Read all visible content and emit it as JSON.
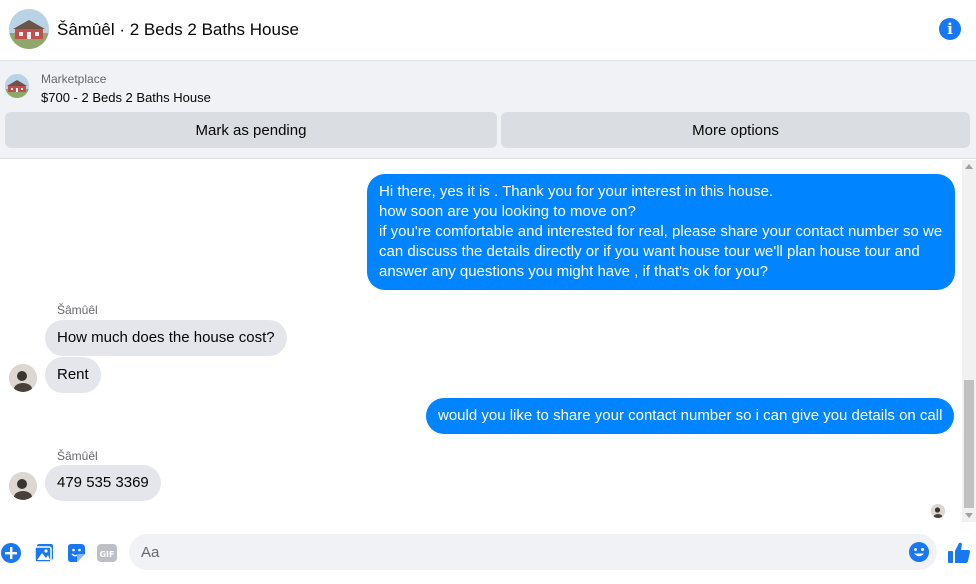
{
  "header": {
    "title": "Šâmûêl · 2 Beds 2 Baths House",
    "info_icon": "info-icon"
  },
  "marketplace": {
    "label": "Marketplace",
    "item": "$700 - 2 Beds 2 Baths House",
    "buttons": {
      "pending": "Mark as pending",
      "more": "More options"
    }
  },
  "messages": {
    "outgoing_1": [
      "Hi there, yes it is . Thank you for your interest in this house.",
      "how soon are you looking to move on?",
      "if you're comfortable and interested for real, please share your contact number so we",
      "can discuss the details directly or if you  want house tour we'll plan house tour and",
      "answer any questions you might have , if that's ok for you?"
    ],
    "incoming_group_1": {
      "sender": "Šâmûêl",
      "msg_1": "How much does the house cost?",
      "msg_2": "Rent"
    },
    "outgoing_2": "would you like to share your contact number so i can give you details on call",
    "incoming_group_2": {
      "sender": "Šâmûêl",
      "msg_1": "479 535 3369"
    }
  },
  "composer": {
    "placeholder": "Aa",
    "icons": [
      "plus-icon",
      "photo-icon",
      "sticker-icon",
      "gif-icon",
      "emoji-icon",
      "thumbs-up-icon"
    ]
  },
  "colors": {
    "accent": "#0084ff",
    "icon_blue": "#1877f2",
    "incoming_bubble": "#e4e6eb",
    "banner_bg": "#f0f2f5"
  }
}
